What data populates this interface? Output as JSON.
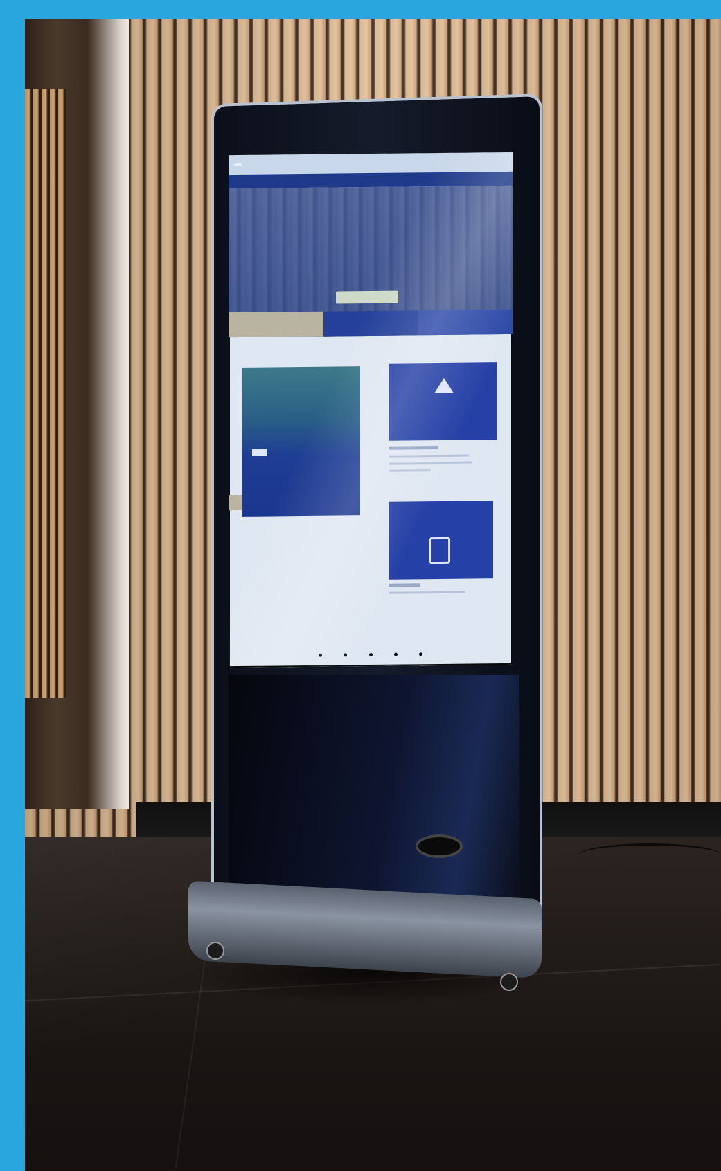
{
  "scene": {
    "description_name": "digital-signage-kiosk",
    "frame_color": "#2aa6df"
  },
  "screen": {
    "hero_title": "",
    "section_title": "",
    "section_subtitle": "",
    "card_big_title": "",
    "card_big_text": "",
    "card_small1_title": "",
    "card_small2_title": "",
    "pager_dots": 5
  },
  "colors": {
    "brand_blue": "#2540a6",
    "nav_blue": "#1f3a8a"
  }
}
